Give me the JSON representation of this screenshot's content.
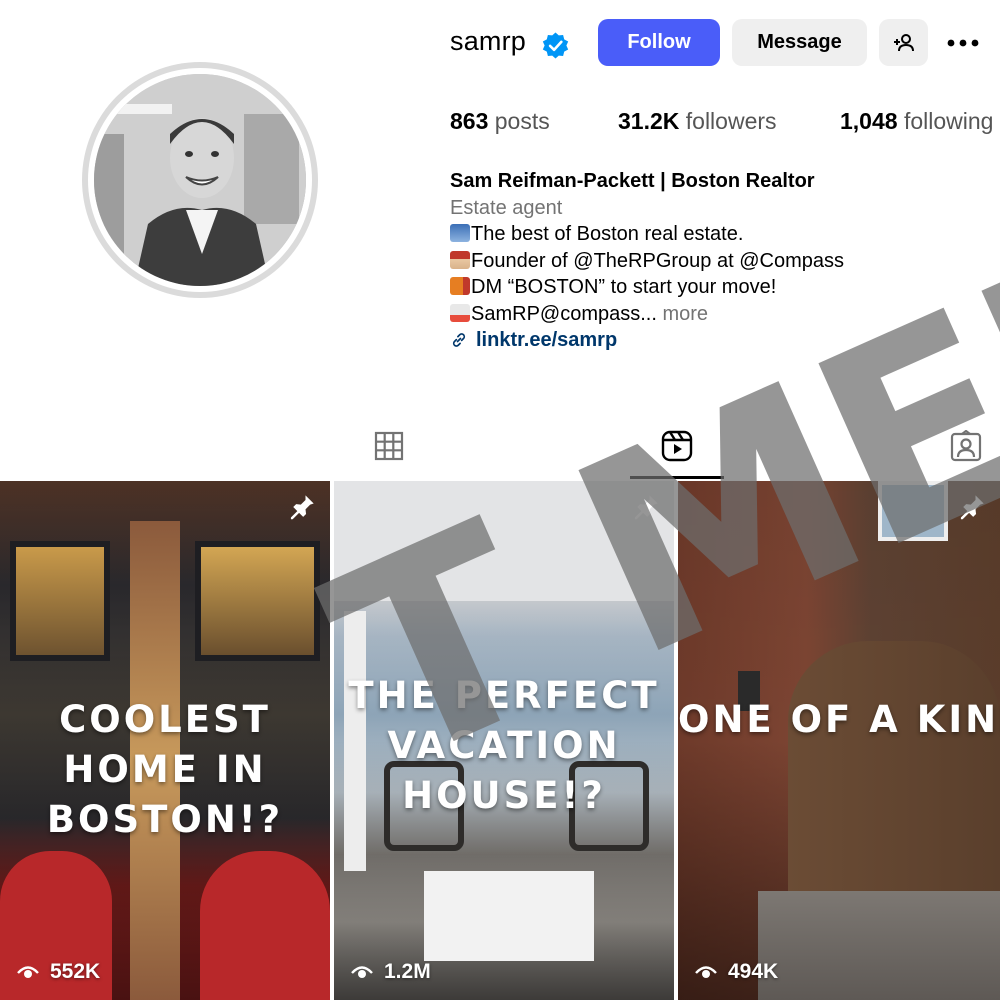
{
  "profile": {
    "username": "samrp",
    "verified": true,
    "avatar_alt": "Profile photo",
    "follow_label": "Follow",
    "message_label": "Message"
  },
  "stats": {
    "posts_count": "863",
    "posts_label": "posts",
    "followers_count": "31.2K",
    "followers_label": "followers",
    "following_count": "1,048",
    "following_label": "following"
  },
  "bio": {
    "name": "Sam Reifman-Packett | Boston Realtor",
    "category": "Estate agent",
    "line1": "The best of Boston real estate.",
    "line2": "Founder of @TheRPGroup at @Compass",
    "line3": "DM “BOSTON” to start your move!",
    "line4": "SamRP@compass...",
    "more_label": "more",
    "link": "linktr.ee/samrp"
  },
  "tabs": [
    {
      "name": "posts",
      "icon": "grid-icon",
      "active": false
    },
    {
      "name": "reels",
      "icon": "reels-icon",
      "active": true
    },
    {
      "name": "tagged",
      "icon": "tagged-icon",
      "active": false
    }
  ],
  "reels": [
    {
      "title": "Coolest home in Boston!?",
      "views": "552K",
      "pinned": true
    },
    {
      "title": "The perfect vacation house!?",
      "views": "1.2M",
      "pinned": true
    },
    {
      "title": "One of a kind Boston loft",
      "views": "494K",
      "pinned": true
    }
  ],
  "watermark": "T MED",
  "colors": {
    "follow_button": "#4a5df9",
    "secondary_button": "#efefef",
    "verified_badge": "#0095f6",
    "link": "#00376b",
    "muted_text": "#737373"
  }
}
